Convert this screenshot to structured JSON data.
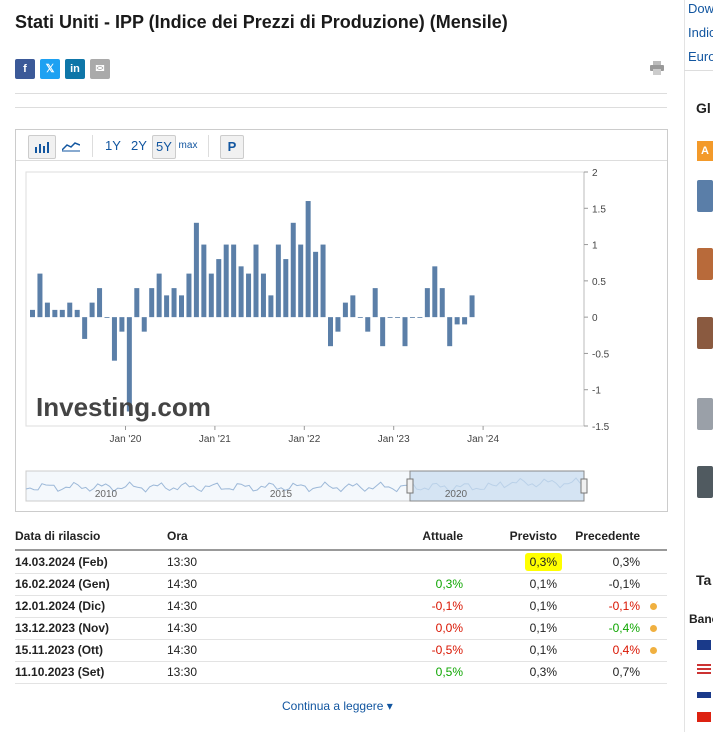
{
  "page": {
    "title": "Stati Uniti - IPP (Indice dei Prezzi di Produzione) (Mensile)",
    "continue_label": "Continua a leggere ▾"
  },
  "share": [
    {
      "name": "facebook-share-button",
      "glyph": "f",
      "color": "#3b5998"
    },
    {
      "name": "x-share-button",
      "glyph": "𝕏",
      "color": "#1da1f2"
    },
    {
      "name": "linkedin-share-button",
      "glyph": "in",
      "color": "#0e76a8"
    },
    {
      "name": "email-share-button",
      "glyph": "✉",
      "color": "#aaaaaa"
    }
  ],
  "toolbar": {
    "ranges": [
      "1Y",
      "2Y",
      "5Y",
      "max"
    ],
    "selected": "5Y",
    "p_label": "P"
  },
  "chart_data": {
    "type": "bar",
    "title": "",
    "xlabel": "",
    "ylabel": "",
    "ylim": [
      -1.5,
      2
    ],
    "y_ticks": [
      "2",
      "1.5",
      "1",
      "0.5",
      "0",
      "-0.5",
      "-1",
      "-1.5"
    ],
    "x_ticks": [
      "Jan '20",
      "Jan '21",
      "Jan '22",
      "Jan '23",
      "Jan '24"
    ],
    "values": [
      0.1,
      0.6,
      0.2,
      0.1,
      0.1,
      0.2,
      0.1,
      -0.3,
      0.2,
      0.4,
      0.0,
      -0.6,
      -0.2,
      -1.3,
      0.4,
      -0.2,
      0.4,
      0.6,
      0.3,
      0.4,
      0.3,
      0.6,
      1.3,
      1.0,
      0.6,
      0.8,
      1.0,
      1.0,
      0.7,
      0.6,
      1.0,
      0.6,
      0.3,
      1.0,
      0.8,
      1.3,
      1.0,
      1.6,
      0.9,
      1.0,
      -0.4,
      -0.2,
      0.2,
      0.3,
      0.0,
      -0.2,
      0.4,
      -0.4,
      0.0,
      0.0,
      -0.4,
      0.0,
      0.0,
      0.4,
      0.7,
      0.4,
      -0.4,
      -0.1,
      -0.1,
      0.3
    ],
    "watermark": "Investing.com",
    "navigator_labels": [
      "2010",
      "2015",
      "2020"
    ],
    "colors": {
      "bar": "#5b7fa8",
      "navigator": "#c8dcf0",
      "watermark": "#444444"
    }
  },
  "table": {
    "headers": {
      "date": "Data di rilascio",
      "time": "Ora",
      "actual": "Attuale",
      "forecast": "Previsto",
      "previous": "Precedente"
    },
    "rows": [
      {
        "date": "14.03.2024 (Feb)",
        "time": "13:30",
        "actual": "",
        "actual_class": "",
        "forecast": "0,3%",
        "forecast_hl": true,
        "previous": "0,3%",
        "previous_class": "",
        "dot": false
      },
      {
        "date": "16.02.2024 (Gen)",
        "time": "14:30",
        "actual": "0,3%",
        "actual_class": "pos",
        "forecast": "0,1%",
        "forecast_hl": false,
        "previous": "-0,1%",
        "previous_class": "",
        "dot": false
      },
      {
        "date": "12.01.2024 (Dic)",
        "time": "14:30",
        "actual": "-0,1%",
        "actual_class": "neg",
        "forecast": "0,1%",
        "forecast_hl": false,
        "previous": "-0,1%",
        "previous_class": "neg",
        "dot": true
      },
      {
        "date": "13.12.2023 (Nov)",
        "time": "14:30",
        "actual": "0,0%",
        "actual_class": "neg",
        "forecast": "0,1%",
        "forecast_hl": false,
        "previous": "-0,4%",
        "previous_class": "pos",
        "dot": true
      },
      {
        "date": "15.11.2023 (Ott)",
        "time": "14:30",
        "actual": "-0,5%",
        "actual_class": "neg",
        "forecast": "0,1%",
        "forecast_hl": false,
        "previous": "0,4%",
        "previous_class": "neg",
        "dot": true
      },
      {
        "date": "11.10.2023 (Set)",
        "time": "13:30",
        "actual": "0,5%",
        "actual_class": "pos",
        "forecast": "0,3%",
        "forecast_hl": false,
        "previous": "0,7%",
        "previous_class": "",
        "dot": false
      }
    ]
  },
  "sidebar": {
    "links": [
      "Dow",
      "Indic",
      "Euro"
    ],
    "heading_1": "Gl",
    "badge": "A",
    "heading_2": "Ta",
    "heading_3": "Banc"
  }
}
